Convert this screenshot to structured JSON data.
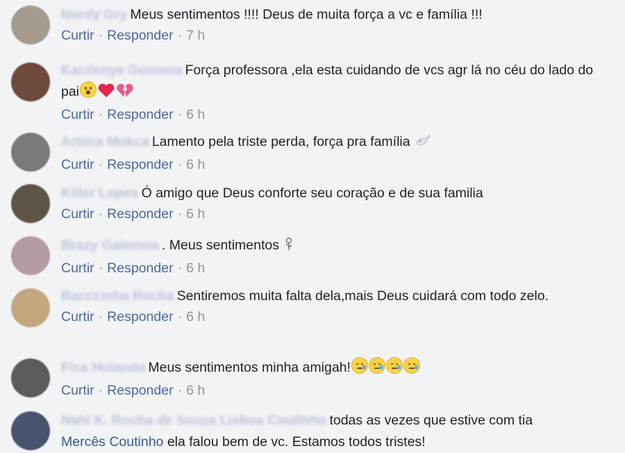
{
  "actions": {
    "like": "Curtir",
    "reply": "Responder",
    "separator": "·"
  },
  "comments": [
    {
      "author": "Nordy Gry",
      "text": "Meus sentimentos !!!! Deus de muita força a vc e família !!!",
      "time": "7 h",
      "avatar_color": "#a49a8e"
    },
    {
      "author": "Kacilenye Gomena",
      "text": "Força professora ,ela esta cuidando de vcs agr lá no céu do lado do pai",
      "emojis": [
        "hushed-face",
        "red-heart",
        "broken-heart"
      ],
      "time": "6 h",
      "avatar_color": "#6d4a3c"
    },
    {
      "author": "Arbica Mokca",
      "text": "Lamento pela triste perda, força pra família",
      "emojis": [
        "dove"
      ],
      "time": "6 h",
      "avatar_color": "#7b7a78"
    },
    {
      "author": "Killer Lopes",
      "text": "Ó amigo que Deus conforte seu coração e de sua familia",
      "time": "6 h",
      "avatar_color": "#5e5448"
    },
    {
      "author": "Brazy Galerieia",
      "text": ". Meus sentimentos",
      "emojis": [
        "rose"
      ],
      "time": "6 h",
      "avatar_color": "#b49ca7"
    },
    {
      "author": "Bacccinha Rocha",
      "text": "Sentiremos muita falta dela,mais Deus cuidará com todo zelo.",
      "time": "6 h",
      "avatar_color": "#c4a77c"
    },
    {
      "author": "Fica Holanda",
      "text": "Meus sentimentos minha amigah!",
      "emojis": [
        "sleepy-face",
        "sleepy-face",
        "sleepy-face",
        "sleepy-face"
      ],
      "time": "6 h",
      "avatar_color": "#5a5d5f"
    },
    {
      "author": "Nahi K. Rocha de Souza Lisboa Coutinho",
      "text": "todas as vezes que estive com tia",
      "mention": "Mercês Coutinho",
      "text_after": "ela falou bem de vc. Estamos todos tristes!",
      "avatar_color": "#4a5470"
    }
  ]
}
